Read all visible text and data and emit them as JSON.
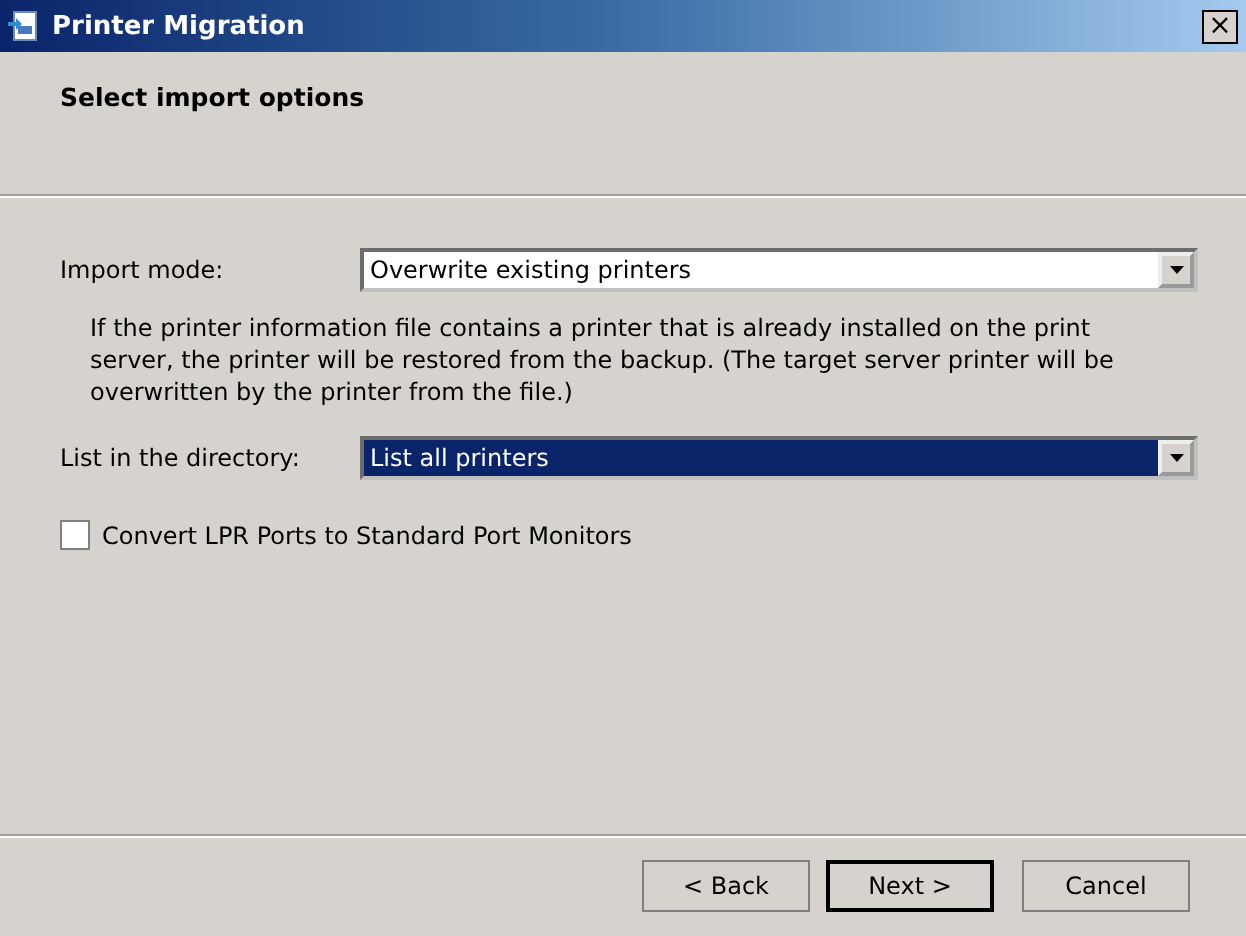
{
  "window": {
    "title": "Printer Migration",
    "close": "×"
  },
  "header": {
    "title": "Select import options"
  },
  "fields": [
    {
      "label": "Import mode:",
      "value": "Overwrite existing printers",
      "focused": false,
      "description": "If the printer information file contains a printer that is already installed on the print server, the printer will be restored from the backup.  (The target server printer will be overwritten by the printer from the file.)"
    },
    {
      "label": "List in the directory:",
      "value": "List all printers",
      "focused": true
    }
  ],
  "checkbox": {
    "label": "Convert LPR Ports to Standard Port Monitors",
    "checked": false
  },
  "buttons": [
    {
      "label": "< Back",
      "default": false
    },
    {
      "label": "Next >",
      "default": true
    },
    {
      "label": "Cancel",
      "default": false
    }
  ]
}
